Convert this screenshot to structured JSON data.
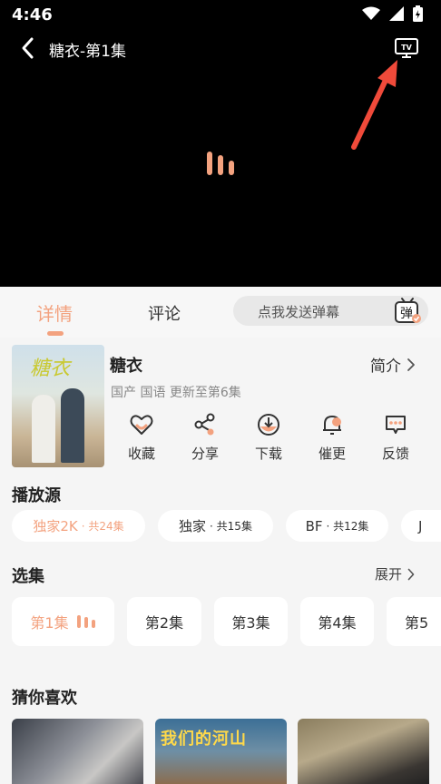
{
  "status_bar": {
    "time": "4:46"
  },
  "player": {
    "title": "糖衣-第1集",
    "icons": [
      "back-arrow-icon",
      "tv-cast-icon",
      "loading-bars-icon"
    ]
  },
  "tabs": {
    "detail": "详情",
    "comment": "评论",
    "danmu_placeholder": "点我发送弹幕",
    "danmu_icon_char": "弹"
  },
  "show": {
    "poster_text": "糖衣",
    "name": "糖衣",
    "meta": "国产 国语 更新至第6集",
    "intro_label": "简介"
  },
  "actions": [
    {
      "label": "收藏",
      "icon": "heart-icon"
    },
    {
      "label": "分享",
      "icon": "share-icon"
    },
    {
      "label": "下载",
      "icon": "download-icon"
    },
    {
      "label": "催更",
      "icon": "bell-icon"
    },
    {
      "label": "反馈",
      "icon": "feedback-icon"
    }
  ],
  "source": {
    "title": "播放源",
    "chips": [
      {
        "name": "独家2K",
        "sub": "· 共24集"
      },
      {
        "name": "独家",
        "sub": "· 共15集"
      },
      {
        "name": "BF",
        "sub": "· 共12集"
      },
      {
        "name": "J",
        "sub": ""
      }
    ]
  },
  "episodes": {
    "title": "选集",
    "expand_label": "展开",
    "items": [
      "第1集",
      "第2集",
      "第3集",
      "第4集",
      "第5"
    ]
  },
  "recommend": {
    "title": "猜你喜欢",
    "items": [
      {
        "poster_text": ""
      },
      {
        "poster_text": "我们的河山"
      },
      {
        "poster_text": ""
      }
    ]
  },
  "colors": {
    "accent": "#f3a27f",
    "player_bg": "#000000",
    "page_bg": "#f5f5f5",
    "annotation_arrow": "#f04a3a"
  }
}
